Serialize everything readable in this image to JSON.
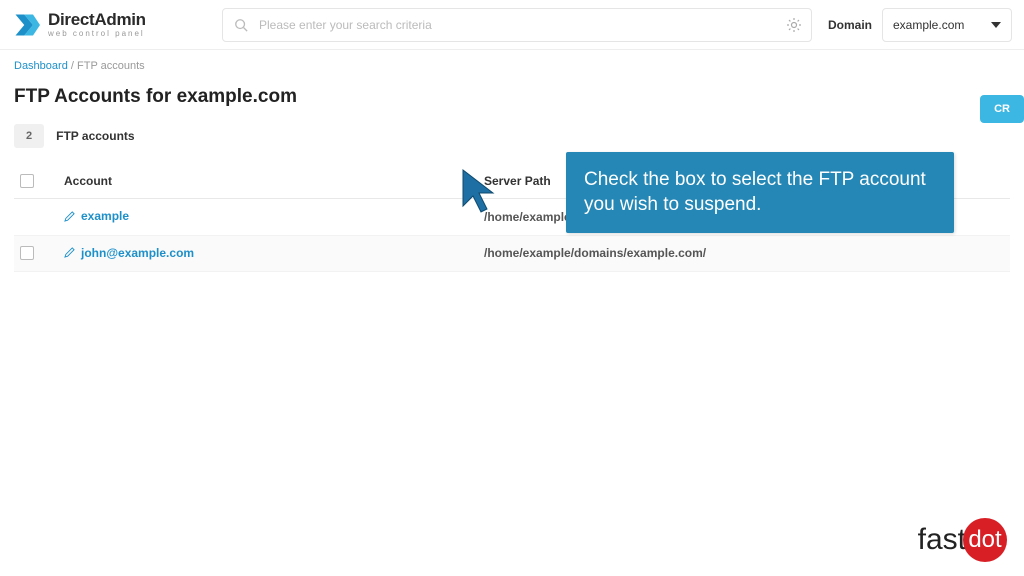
{
  "header": {
    "logo_text": "DirectAdmin",
    "logo_sub": "web control panel",
    "search_placeholder": "Please enter your search criteria",
    "domain_label": "Domain",
    "domain_value": "example.com"
  },
  "breadcrumb": {
    "root": "Dashboard",
    "current": "FTP accounts"
  },
  "title": "FTP Accounts for example.com",
  "create_label": "CR",
  "count": {
    "value": "2",
    "label": "FTP accounts"
  },
  "columns": {
    "account": "Account",
    "path": "Server Path"
  },
  "rows": [
    {
      "account": "example",
      "path": "/home/example/"
    },
    {
      "account": "john@example.com",
      "path": "/home/example/domains/example.com/"
    }
  ],
  "tip": "Check the box to select the FTP account you wish to suspend.",
  "footer": {
    "a": "fast",
    "b": "dot"
  }
}
